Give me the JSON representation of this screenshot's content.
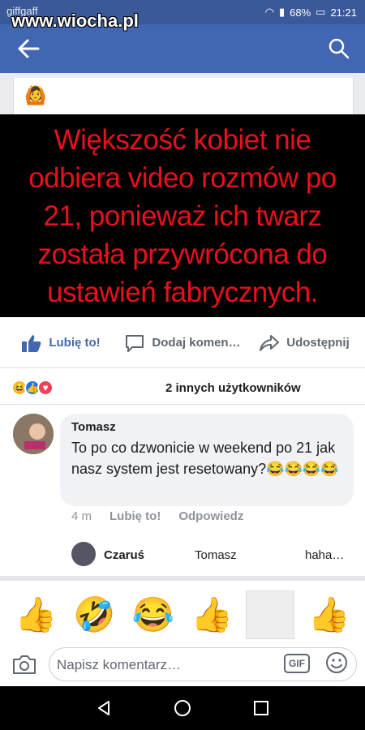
{
  "status": {
    "left_text": "giffgaff",
    "battery": "68%",
    "time": "21:21"
  },
  "watermark": "www.wiocha.pl",
  "meme": {
    "text": "Większość kobiet nie odbiera video rozmów po 21, ponieważ ich twarz została przywrócona do ustawień fabrycznych."
  },
  "actions": {
    "like": "Lubię to!",
    "comment": "Dodaj komen…",
    "share": "Udostępnij"
  },
  "reactions": {
    "summary": "2 innych użytkowników"
  },
  "comment": {
    "author": "Tomasz",
    "text": "To po co dzwonicie w weekend po 21 jak nasz system jest resetowany?😂😂😂😂",
    "time": "4 m",
    "like": "Lubię to!",
    "reply": "Odpowiedz"
  },
  "reply": {
    "author": "Czaruś",
    "to": "Tomasz",
    "text": "haha…"
  },
  "composer": {
    "placeholder": "Napisz komentarz…",
    "gif": "GIF"
  },
  "colors": {
    "fb_blue": "#4267b2",
    "status_blue": "#3b5998",
    "meme_red": "#e8101d"
  }
}
